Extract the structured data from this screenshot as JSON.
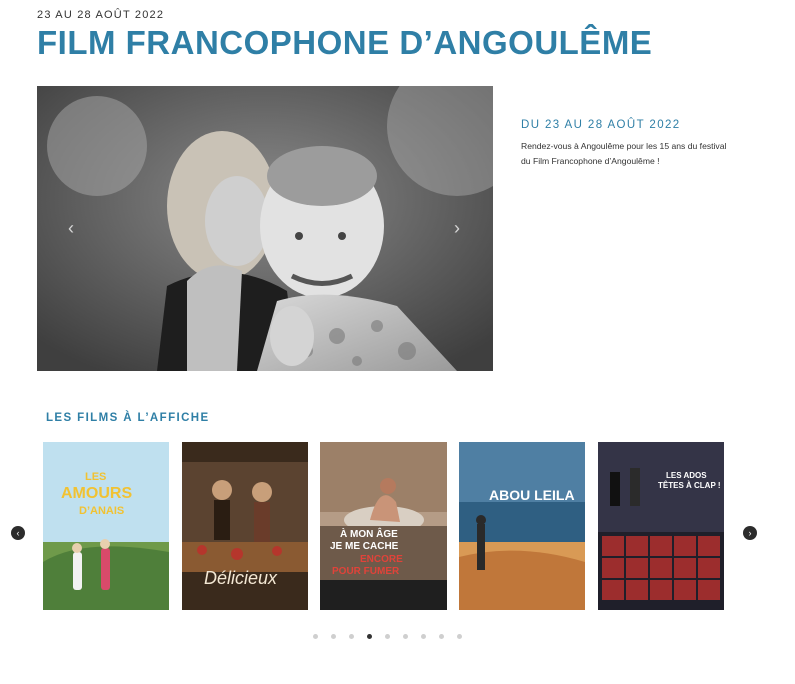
{
  "header": {
    "date_line": "23 AU 28 AOÛT 2022",
    "title": "FILM FRANCOPHONE D’ANGOULÊME"
  },
  "hero": {
    "prev_icon": "chevron-left-icon",
    "next_icon": "chevron-right-icon",
    "prev_glyph": "‹",
    "next_glyph": "›"
  },
  "event": {
    "date_title": "DU 23 AU 28 AOÛT 2022",
    "description": "Rendez-vous à Angoulême pour les 15 ans du festival du Film Francophone d’Angoulême !"
  },
  "section": {
    "title": "LES FILMS À L’AFFICHE"
  },
  "posters": [
    {
      "title_lines": [
        "LES",
        "AMOURS",
        "D’ANAIS"
      ]
    },
    {
      "title_lines": [
        "Délicieux"
      ]
    },
    {
      "title_lines": [
        "À MON ÂGE",
        "JE ME CACHE",
        "ENCORE",
        "POUR FUMER"
      ]
    },
    {
      "title_lines": [
        "ABOU LEILA"
      ]
    },
    {
      "title_lines": [
        "LES ADOS",
        "TÊTES À CLAP !"
      ]
    }
  ],
  "carousel": {
    "prev_glyph": "‹",
    "next_glyph": "›",
    "dot_count": 9,
    "active_dot": 4
  },
  "colors": {
    "accent": "#2f7fa6"
  }
}
